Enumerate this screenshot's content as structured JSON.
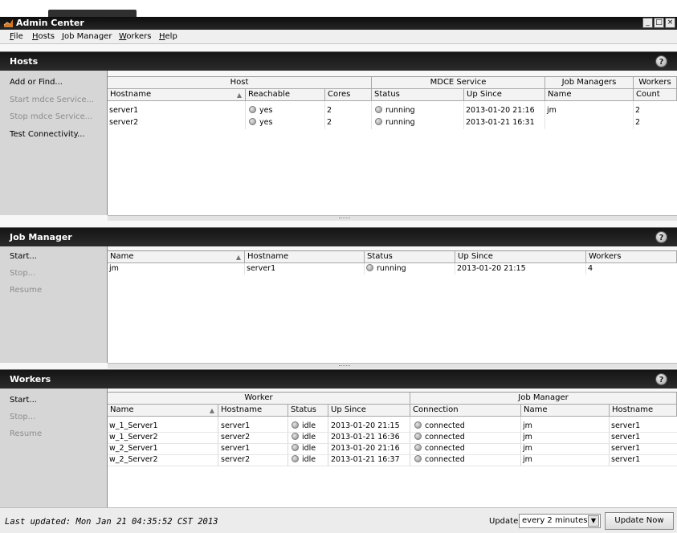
{
  "window": {
    "title": "Admin Center"
  },
  "menu": [
    {
      "label": "File",
      "u": "F",
      "rest": "ile"
    },
    {
      "label": "Hosts",
      "u": "H",
      "rest": "osts"
    },
    {
      "label": "Job Manager",
      "u": "J",
      "rest": "ob Manager"
    },
    {
      "label": "Workers",
      "u": "W",
      "rest": "orkers"
    },
    {
      "label": "Help",
      "u": "H",
      "rest": "elp"
    }
  ],
  "hosts": {
    "title": "Hosts",
    "actions": [
      {
        "label": "Add or Find...",
        "enabled": true
      },
      {
        "label": "Start mdce Service...",
        "enabled": false
      },
      {
        "label": "Stop mdce Service...",
        "enabled": false
      },
      {
        "label": "Test Connectivity...",
        "enabled": true
      }
    ],
    "groups": [
      "Host",
      "MDCE Service",
      "Job Managers",
      "Workers"
    ],
    "columns": [
      "Hostname",
      "Reachable",
      "Cores",
      "Status",
      "Up Since",
      "Name",
      "Count"
    ],
    "rows": [
      {
        "hostname": "server1",
        "reachable": "yes",
        "cores": "2",
        "status": "running",
        "up_since": "2013-01-20 21:16",
        "name": "jm",
        "count": "2"
      },
      {
        "hostname": "server2",
        "reachable": "yes",
        "cores": "2",
        "status": "running",
        "up_since": "2013-01-21 16:31",
        "name": "",
        "count": "2"
      }
    ]
  },
  "job_manager": {
    "title": "Job Manager",
    "actions": [
      {
        "label": "Start...",
        "enabled": true
      },
      {
        "label": "Stop...",
        "enabled": false
      },
      {
        "label": "Resume",
        "enabled": false
      }
    ],
    "columns": [
      "Name",
      "Hostname",
      "Status",
      "Up Since",
      "Workers"
    ],
    "rows": [
      {
        "name": "jm",
        "hostname": "server1",
        "status": "running",
        "up_since": "2013-01-20 21:15",
        "workers": "4"
      }
    ]
  },
  "workers": {
    "title": "Workers",
    "actions": [
      {
        "label": "Start...",
        "enabled": true
      },
      {
        "label": "Stop...",
        "enabled": false
      },
      {
        "label": "Resume",
        "enabled": false
      }
    ],
    "groups": [
      "Worker",
      "Job Manager"
    ],
    "columns": [
      "Name",
      "Hostname",
      "Status",
      "Up Since",
      "Connection",
      "Name",
      "Hostname"
    ],
    "rows": [
      {
        "name": "w_1_Server1",
        "hostname": "server1",
        "status": "idle",
        "up_since": "2013-01-20 21:15",
        "connection": "connected",
        "jm_name": "jm",
        "jm_hostname": "server1"
      },
      {
        "name": "w_1_Server2",
        "hostname": "server2",
        "status": "idle",
        "up_since": "2013-01-21 16:36",
        "connection": "connected",
        "jm_name": "jm",
        "jm_hostname": "server1"
      },
      {
        "name": "w_2_Server1",
        "hostname": "server1",
        "status": "idle",
        "up_since": "2013-01-20 21:16",
        "connection": "connected",
        "jm_name": "jm",
        "jm_hostname": "server1"
      },
      {
        "name": "w_2_Server2",
        "hostname": "server2",
        "status": "idle",
        "up_since": "2013-01-21 16:37",
        "connection": "connected",
        "jm_name": "jm",
        "jm_hostname": "server1"
      }
    ]
  },
  "footer": {
    "last_updated": "Last updated: Mon Jan 21 04:35:52 CST 2013",
    "update_label": "Update",
    "update_interval": "every 2 minutes",
    "update_now": "Update Now"
  },
  "icons": {
    "app": "admin-center-icon",
    "help": "help-icon",
    "status": "status-dot-icon",
    "dropdown": "dropdown-arrow-icon",
    "sort": "sort-indicator-icon"
  }
}
